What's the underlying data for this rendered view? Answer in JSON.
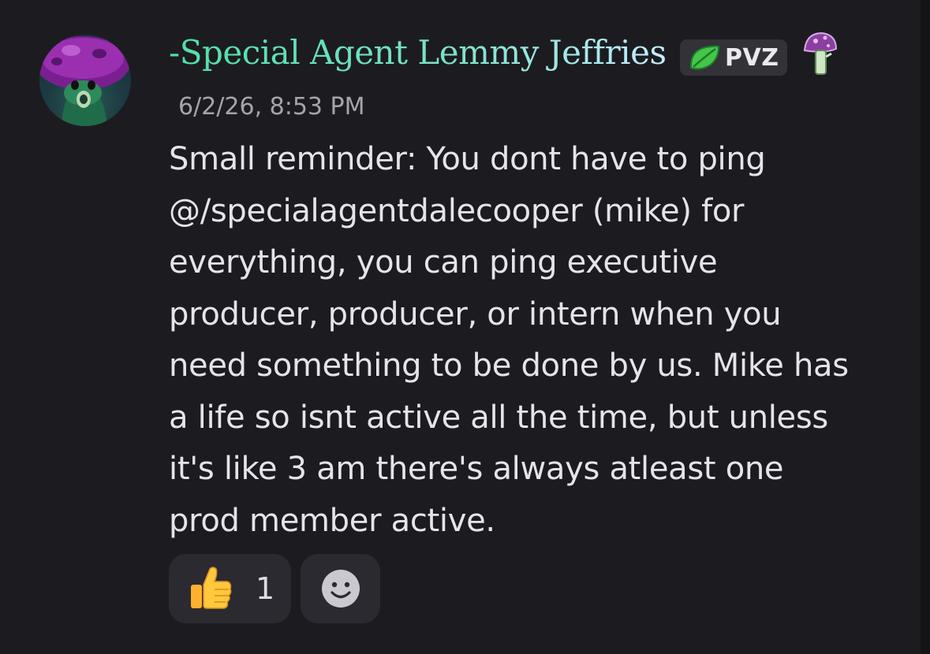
{
  "message": {
    "author": {
      "display_name": "-Special Agent Lemmy Jeffries",
      "avatar_icon": "mushroom-character-avatar",
      "name_gradient": [
        "#4fe0a6",
        "#7ae1c9",
        "#c6ecff"
      ]
    },
    "tag": {
      "icon": "leaf-icon",
      "label": "PVZ"
    },
    "role_icon": "purple-mushroom-icon",
    "timestamp": "6/2/26, 8:53 PM",
    "content_lines": [
      "Small reminder: You dont have to ping",
      "@/specialagentdalecooper (mike) for",
      "everything, you can ping executive",
      "producer, producer, or intern when you",
      "need something to be done by us. Mike has",
      "a life so isnt active all the time, but unless",
      "it's like 3 am there's always atleast one",
      "prod member active."
    ]
  },
  "reactions": [
    {
      "emoji": "thumbs-up-icon",
      "count": "1"
    }
  ],
  "add_reaction_icon": "smiley-face-icon",
  "colors": {
    "background": "#1c1c20",
    "reaction_bg": "#2a2a30",
    "text": "#e4e4ea",
    "timestamp": "#a4a4ac"
  }
}
